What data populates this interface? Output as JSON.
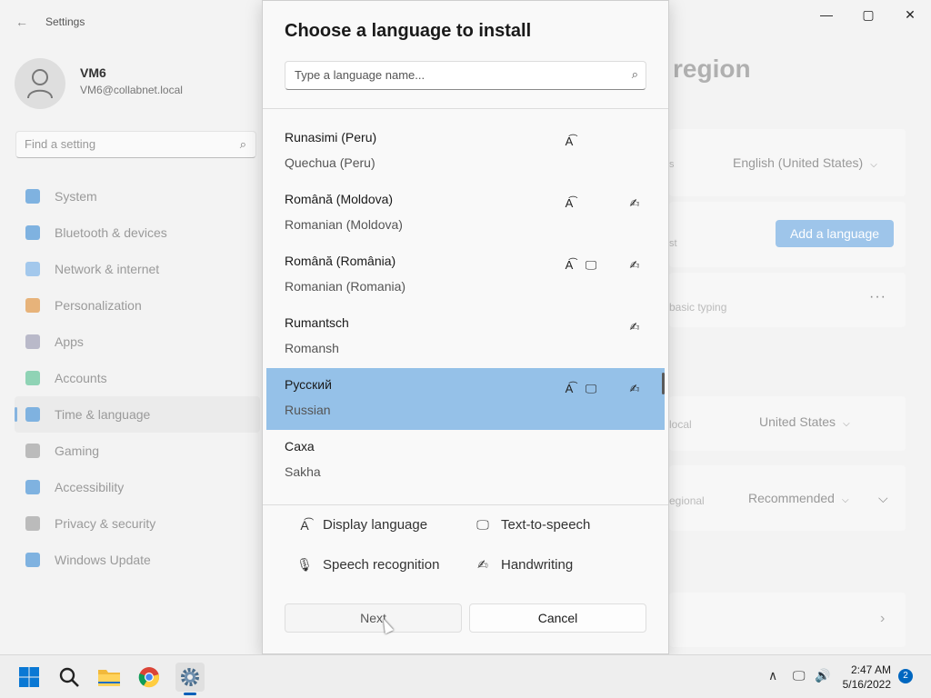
{
  "settings": {
    "app_title": "Settings",
    "user": {
      "name": "VM6",
      "email": "VM6@collabnet.local"
    },
    "search_placeholder": "Find a setting",
    "nav_items": [
      {
        "label": "System",
        "icon": "monitor-icon",
        "color": "#7fb2e0"
      },
      {
        "label": "Bluetooth & devices",
        "icon": "bluetooth-icon",
        "color": "#7fb2e0"
      },
      {
        "label": "Network & internet",
        "icon": "wifi-icon",
        "color": "#a3c8ec"
      },
      {
        "label": "Personalization",
        "icon": "brush-icon",
        "color": "#e7b37a"
      },
      {
        "label": "Apps",
        "icon": "apps-icon",
        "color": "#b9b9c9"
      },
      {
        "label": "Accounts",
        "icon": "person-icon",
        "color": "#8fd3b5"
      },
      {
        "label": "Time & language",
        "icon": "globe-clock-icon",
        "color": "#7fb2e0"
      },
      {
        "label": "Gaming",
        "icon": "gamepad-icon",
        "color": "#bbbbbb"
      },
      {
        "label": "Accessibility",
        "icon": "accessibility-icon",
        "color": "#7fb2e0"
      },
      {
        "label": "Privacy & security",
        "icon": "shield-icon",
        "color": "#bbbbbb"
      },
      {
        "label": "Windows Update",
        "icon": "update-icon",
        "color": "#7fb2e0"
      }
    ],
    "page_title": "region",
    "display_language_value": "English (United States)",
    "add_language_label": "Add a language",
    "basic_typing_hint": "basic typing",
    "country_value": "United States",
    "regional_format_value": "Recommended",
    "hint_s": "s",
    "hint_st": "st",
    "hint_local": "local",
    "hint_regional": "egional"
  },
  "dialog": {
    "title": "Choose a language to install",
    "search_placeholder": "Type a language name...",
    "languages": [
      {
        "native": "Runasimi (Peru)",
        "english": "Quechua (Peru)",
        "display": true,
        "tts": false,
        "handwriting": false,
        "selected": false
      },
      {
        "native": "Română (Moldova)",
        "english": "Romanian (Moldova)",
        "display": true,
        "tts": false,
        "handwriting": true,
        "selected": false
      },
      {
        "native": "Română (România)",
        "english": "Romanian (Romania)",
        "display": true,
        "tts": true,
        "handwriting": true,
        "selected": false
      },
      {
        "native": "Rumantsch",
        "english": "Romansh",
        "display": false,
        "tts": false,
        "handwriting": true,
        "selected": false
      },
      {
        "native": "Русский",
        "english": "Russian",
        "display": true,
        "tts": true,
        "handwriting": true,
        "selected": true
      },
      {
        "native": "Саха",
        "english": "Sakha",
        "display": false,
        "tts": false,
        "handwriting": false,
        "selected": false
      }
    ],
    "legend": {
      "display_language": "Display language",
      "text_to_speech": "Text-to-speech",
      "speech_recognition": "Speech recognition",
      "handwriting": "Handwriting"
    },
    "next_label": "Next",
    "cancel_label": "Cancel"
  },
  "taskbar": {
    "time": "2:47 AM",
    "date": "5/16/2022",
    "notification_count": "2"
  }
}
